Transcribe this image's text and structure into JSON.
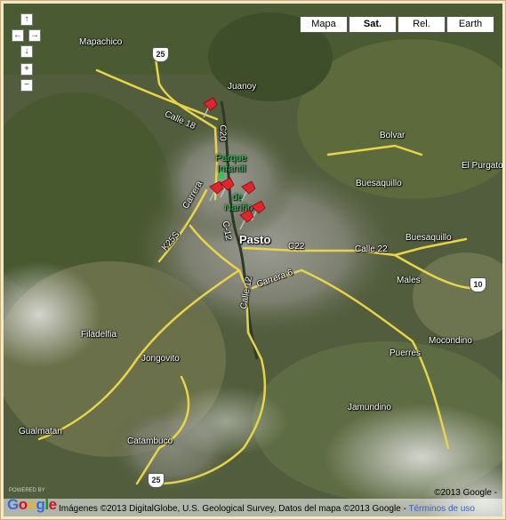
{
  "map_type_buttons": [
    {
      "label": "Mapa",
      "active": false
    },
    {
      "label": "Sat.",
      "active": true
    },
    {
      "label": "Rel.",
      "active": false
    },
    {
      "label": "Earth",
      "active": false
    }
  ],
  "nav_controls": {
    "up": "↑",
    "left": "←",
    "right": "→",
    "down": "↓",
    "zoom_in": "+",
    "zoom_out": "−"
  },
  "place_labels": {
    "mapachico": "Mapachico",
    "juanoy": "Juanoy",
    "bolvar": "Bolvar",
    "el_purgato": "El Purgato",
    "buesaquillo_north": "Buesaquillo",
    "buesaquillo_east": "Buesaquillo",
    "pasto": "Pasto",
    "males": "Males",
    "mocondino": "Mocondino",
    "puerres": "Puerres",
    "jamundino": "Jamundino",
    "filadelfia": "Filadelfia",
    "jongovito": "Jongovito",
    "gualmatan": "Gualmatan",
    "catambuco": "Catambuco"
  },
  "poi_labels": {
    "parque": "Parque",
    "infantil": "Infantil",
    "de": "de",
    "narino": "Nariño"
  },
  "street_labels": {
    "calle_18": "Calle 18",
    "c20": "C20",
    "carrera": "Carrera",
    "c12": "C-12",
    "k25s": "K25S",
    "c22": "C22",
    "calle_22": "Calle 22",
    "carrera_6": "Carrera 6",
    "calle_12": "Calle 12"
  },
  "route_shields": [
    "25",
    "10",
    "25"
  ],
  "attribution": {
    "copyright": "©2013 Google -",
    "imagery": "Imágenes ©2013 DigitalGlobe, U.S. Geological Survey, Datos del mapa ©2013 Google -",
    "terms": "Términos de uso",
    "logo": "Google",
    "powered": "POWERED BY"
  },
  "colors": {
    "road": "#e8d44a",
    "pin": "#e0252c",
    "frame": "#f4e8c8"
  }
}
